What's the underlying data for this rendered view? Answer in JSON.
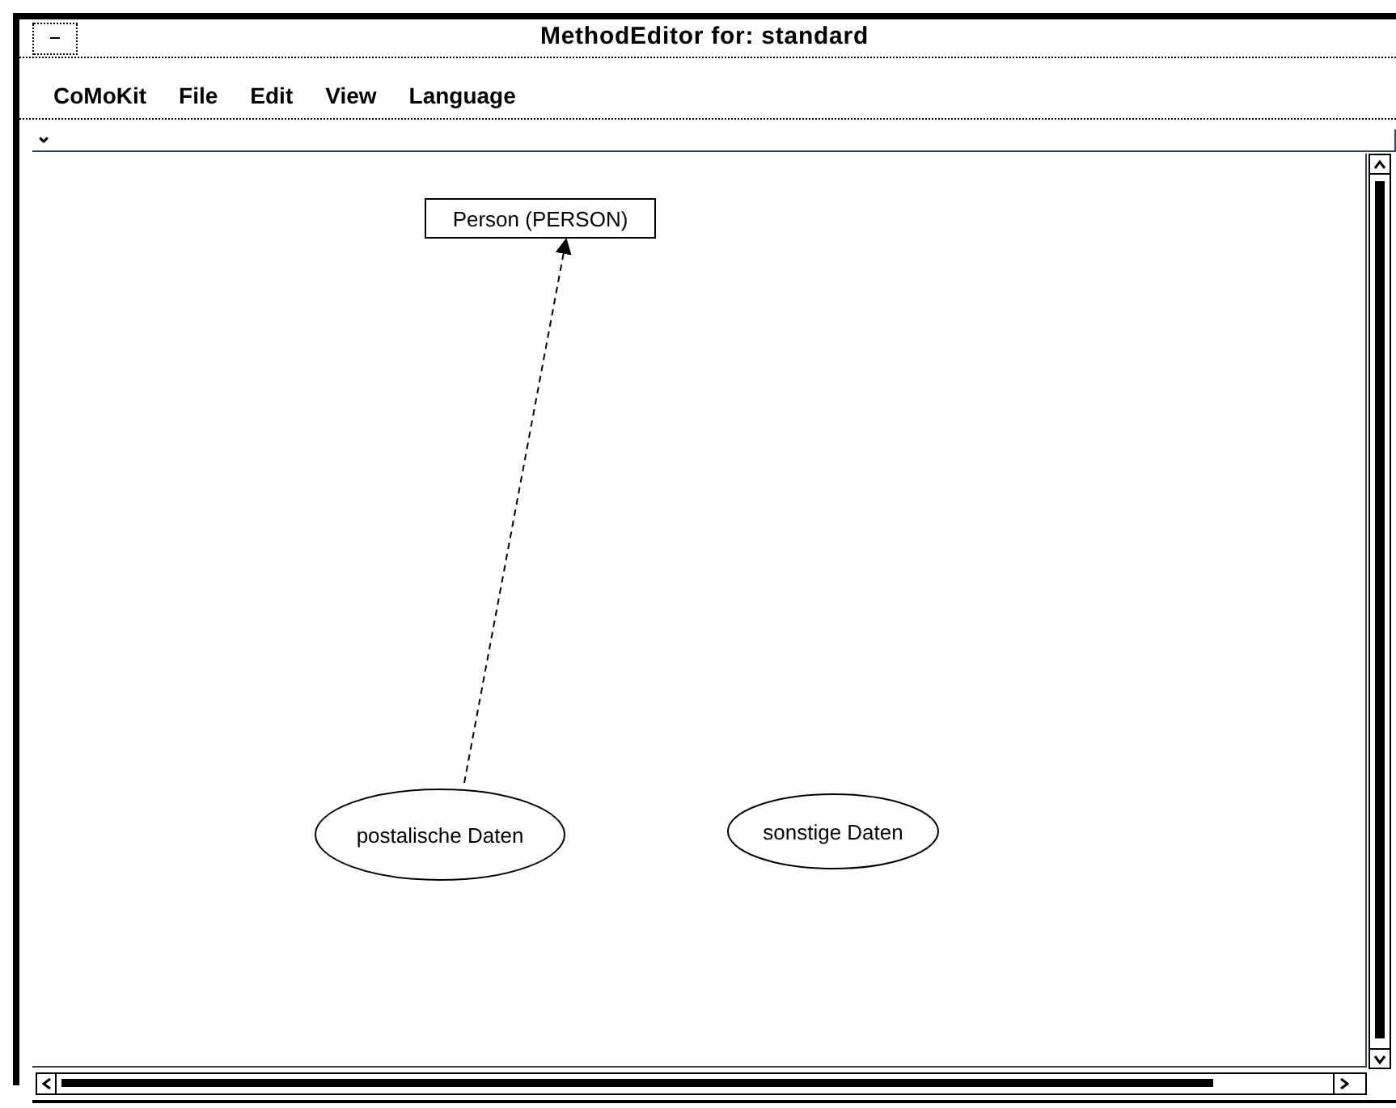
{
  "window": {
    "title": "MethodEditor for: standard"
  },
  "menu": [
    "CoMoKit",
    "File",
    "Edit",
    "View",
    "Language"
  ],
  "toolbar": {
    "collapse_glyph": "⌄"
  },
  "diagram": {
    "nodes": [
      {
        "kind": "box",
        "label": "Person (PERSON)"
      },
      {
        "kind": "ellipse",
        "label": "postalische Daten"
      },
      {
        "kind": "ellipse",
        "label": "sonstige Daten"
      }
    ]
  }
}
